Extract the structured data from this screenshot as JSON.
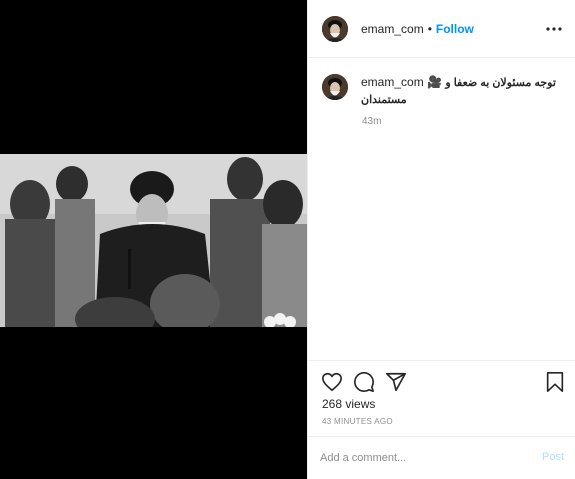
{
  "post": {
    "username": "emam_com",
    "dot": "•",
    "follow_label": "Follow",
    "caption_user": "emam_com",
    "caption_text": "توجه مسئولان به ضعفا و مستمندان",
    "caption_emoji": "🎥",
    "time_ago": "43m",
    "views": "268 views",
    "posted_ago": "43 MINUTES AGO"
  },
  "icons": {
    "more": "more-horizontal-icon",
    "like": "heart-icon",
    "comment": "comment-icon",
    "share": "share-icon",
    "save": "bookmark-icon"
  },
  "comment": {
    "placeholder": "Add a comment...",
    "post_label": "Post"
  },
  "colors": {
    "accent": "#0095f6",
    "post_disabled": "#b2dffc",
    "muted": "#8e8e8e"
  }
}
